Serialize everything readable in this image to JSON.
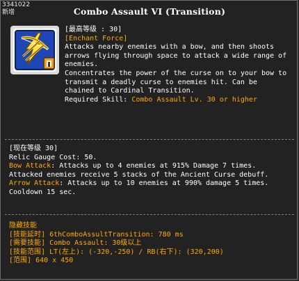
{
  "tooltip": {
    "skill_id": "3341022",
    "new_tag": "新增",
    "title": "Combo Assault VI (Transition)"
  },
  "header": {
    "max_level": "[最高等级 : 30]",
    "tag": "[Enchant Force]",
    "desc_lines": [
      "Attacks nearby enemies with a bow, and then shoots",
      "arrows flying through space to attack a wide range of",
      "enemies.",
      "Concentrates the power of the curse on to your bow to",
      "transmit a deadly curse to enemies hit. Can be",
      "chained to Cardinal Transition."
    ],
    "required_label": "Required Skill: ",
    "required_value": "Combo Assault Lv. 30 or higher"
  },
  "level": {
    "current_level": "[现在等级 30]",
    "relic_cost": "Relic Gauge Cost: 50.",
    "bow_label": "Bow Attack",
    "bow_text": ": Attacks up to 4 enemies at 915% Damage 7 times.",
    "curse_text": "Attacked enemies receive 5 stacks of the Ancient Curse debuff.",
    "arrow_label": "Arrow Attack",
    "arrow_text": ": Attacks up to 10 enemies at 990% damage 5 times.",
    "cooldown": "Cooldown 15 sec."
  },
  "extra": {
    "hidden_title": "隐藏技能",
    "delay_label": "[技能延时] ",
    "delay_value": "6thComboAssultTransition: 780 ms",
    "req_label": "[需要技能] ",
    "req_value": "Combo Assault: 30级以上",
    "range_label": "[技能范围] ",
    "range_value": "LT(左上): (-320,-250) / RB(右下): (320,200)",
    "area_label": "[范围] ",
    "area_value": "640 x 450"
  },
  "colors": {
    "accent_orange": "#ffaa00",
    "background": "#222222",
    "text": "#ffffff"
  },
  "icon": {
    "name": "combo-assault-bow-icon"
  }
}
